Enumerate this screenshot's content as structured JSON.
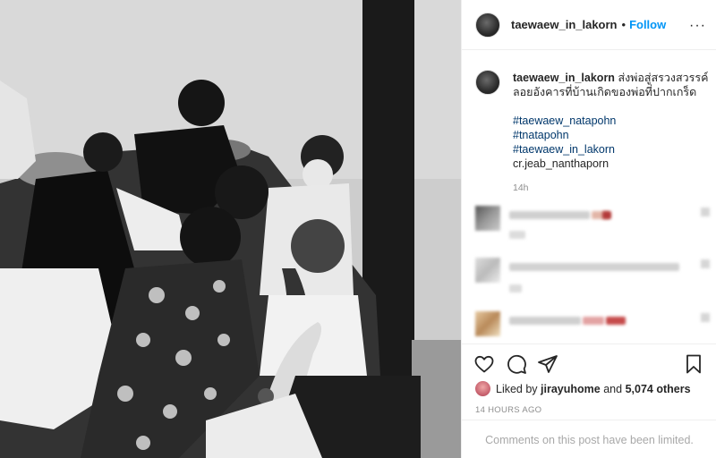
{
  "post": {
    "username": "taewaew_in_lakorn",
    "follow_label": "Follow",
    "dot": "•",
    "more_label": "···"
  },
  "caption": {
    "username": "taewaew_in_lakorn",
    "text_line1": "ส่งพ่อสู่สรวงสวรรค์",
    "text_line2": "ลอยอังคารที่บ้านเกิดของพ่อที่ปากเกร็ด",
    "hashtags": [
      "#taewaew_natapohn",
      "#tnatapohn",
      "#taewaew_in_lakorn"
    ],
    "credit": "cr.jeab_nanthaporn",
    "time": "14h"
  },
  "likes": {
    "liked_by_prefix": "Liked by",
    "liked_by_user": "jirayuhome",
    "and_label": "and",
    "others_count": "5,074 others"
  },
  "timestamp": "14 HOURS AGO",
  "comments_limited": "Comments on this post have been limited.",
  "icons": {
    "like": "heart-icon",
    "comment": "comment-bubble-icon",
    "share": "paper-plane-icon",
    "save": "bookmark-icon",
    "more": "more-dots-icon"
  },
  "colors": {
    "link_blue": "#0095f6",
    "hashtag": "#00376b",
    "muted": "#8e8e8e"
  }
}
